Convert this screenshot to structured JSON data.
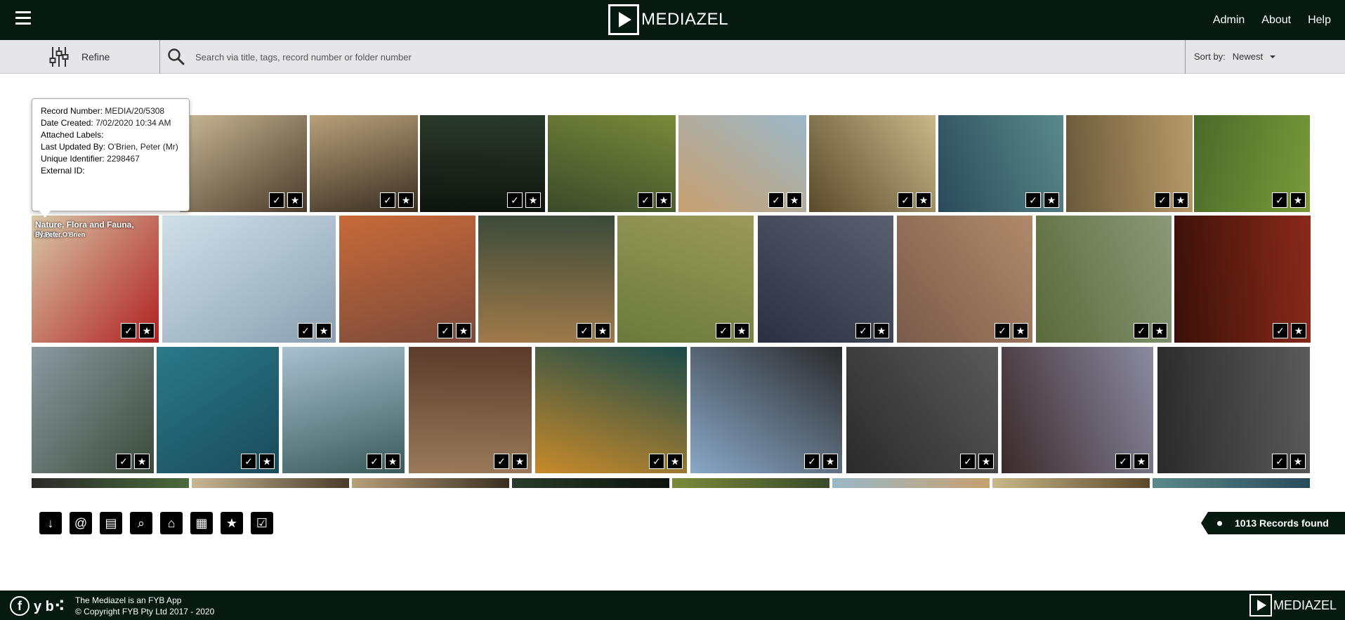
{
  "header": {
    "logo_text": "MEDIAZEL",
    "nav": [
      "Admin",
      "About",
      "Help"
    ]
  },
  "search": {
    "refine_label": "Refine",
    "placeholder": "Search via title, tags, record number or folder number",
    "sort_label": "Sort by:",
    "sort_value": "Newest"
  },
  "tooltip": {
    "record_number_label": "Record Number:",
    "record_number": "MEDIA/20/5308",
    "date_created_label": "Date Created:",
    "date_created": "7/02/2020 10:34 AM",
    "attached_labels_label": "Attached Labels:",
    "attached_labels": "",
    "last_updated_label": "Last Updated By:",
    "last_updated": "O'Brien, Peter (Mr)",
    "unique_id_label": "Unique Identifier:",
    "unique_id": "2298467",
    "external_id_label": "External ID:",
    "external_id": ""
  },
  "hover_tile": {
    "title": "Nature, Flora and Fauna, Plant...",
    "byline": "By Peter O'Brien"
  },
  "tiles": [
    {
      "color": "#c9b896",
      "color2": "#4a3a2a"
    },
    {
      "color": "#b8a07a",
      "color2": "#3a2e22"
    },
    {
      "color": "#2a3a2a",
      "color2": "#0e140e"
    },
    {
      "color": "#7a8a3a",
      "color2": "#3a4a2a"
    },
    {
      "color": "#9bb8c8",
      "color2": "#c8a070"
    },
    {
      "color": "#c8b88a",
      "color2": "#5a4a2a"
    },
    {
      "color": "#5a8a8a",
      "color2": "#2a4a5a"
    },
    {
      "color": "#b89a6a",
      "color2": "#6a5a3a"
    },
    {
      "color": "#7a9a3a",
      "color2": "#4a6a2a"
    },
    {
      "color": "#d8c8a8",
      "color2": "#b02020"
    },
    {
      "color": "#d0e0ea",
      "color2": "#8aa0b0"
    },
    {
      "color": "#c86a3a",
      "color2": "#7a4a3a"
    },
    {
      "color": "#3a4a3a",
      "color2": "#a07a4a"
    },
    {
      "color": "#9a9a5a",
      "color2": "#6a7a3a"
    },
    {
      "color": "#5a6070",
      "color2": "#2a3040"
    },
    {
      "color": "#b08a6a",
      "color2": "#7a5a4a"
    },
    {
      "color": "#8a9a7a",
      "color2": "#5a6a3a"
    },
    {
      "color": "#8a2a1a",
      "color2": "#3a1008"
    },
    {
      "color": "#8a9aa0",
      "color2": "#3a4a3a"
    },
    {
      "color": "#2a7a8a",
      "color2": "#1a4a5a"
    },
    {
      "color": "#a8c0d0",
      "color2": "#3a5a5a"
    },
    {
      "color": "#5a3a2a",
      "color2": "#9a7a5a"
    },
    {
      "color": "#1a4a4a",
      "color2": "#c88a2a"
    },
    {
      "color": "#2a2a2a",
      "color2": "#8aa8c8"
    },
    {
      "color": "#5a5a5a",
      "color2": "#2a2a2a"
    },
    {
      "color": "#8a8aa0",
      "color2": "#3a2a2a"
    },
    {
      "color": "#5a5a5a",
      "color2": "#2a2a2a"
    },
    {
      "color": "#2a2a2a",
      "color2": "#4a6a3a"
    }
  ],
  "toolbar_icons": [
    "download-icon",
    "email-icon",
    "folder-icon",
    "search-document-icon",
    "tag-icon",
    "document-icon",
    "star-icon",
    "checkbox-icon"
  ],
  "records": "1013 Records found",
  "footer": {
    "line1": "The Mediazel is an FYB App",
    "line2": "© Copyright FYB Pty Ltd 2017 - 2020",
    "logo_text": "MEDIAZEL"
  }
}
